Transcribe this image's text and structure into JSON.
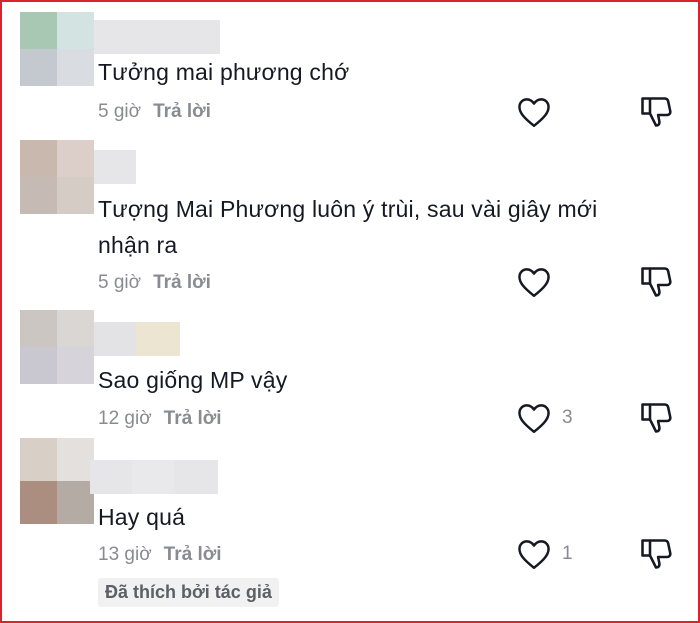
{
  "comments": [
    {
      "text": "Tưởng mai phương chớ",
      "time": "5 giờ",
      "reply": "Trả lời",
      "likes": ""
    },
    {
      "text": "Tượng Mai Phương luôn ý trùi, sau vài giây mới nhận ra",
      "time": "5 giờ",
      "reply": "Trả lời",
      "likes": ""
    },
    {
      "text": "Sao giống MP vậy",
      "time": "12 giờ",
      "reply": "Trả lời",
      "likes": "3"
    },
    {
      "text": "Hay quá",
      "time": "13 giờ",
      "reply": "Trả lời",
      "likes": "1",
      "badge": "Đã thích bởi tác giả"
    }
  ],
  "colors": {
    "border": "#d9232d",
    "text": "#161823",
    "muted": "#8a8b91",
    "badge_bg": "#f1f1f2"
  },
  "icons": {
    "like": "heart-outline-icon",
    "dislike": "thumbs-down-outline-icon"
  }
}
